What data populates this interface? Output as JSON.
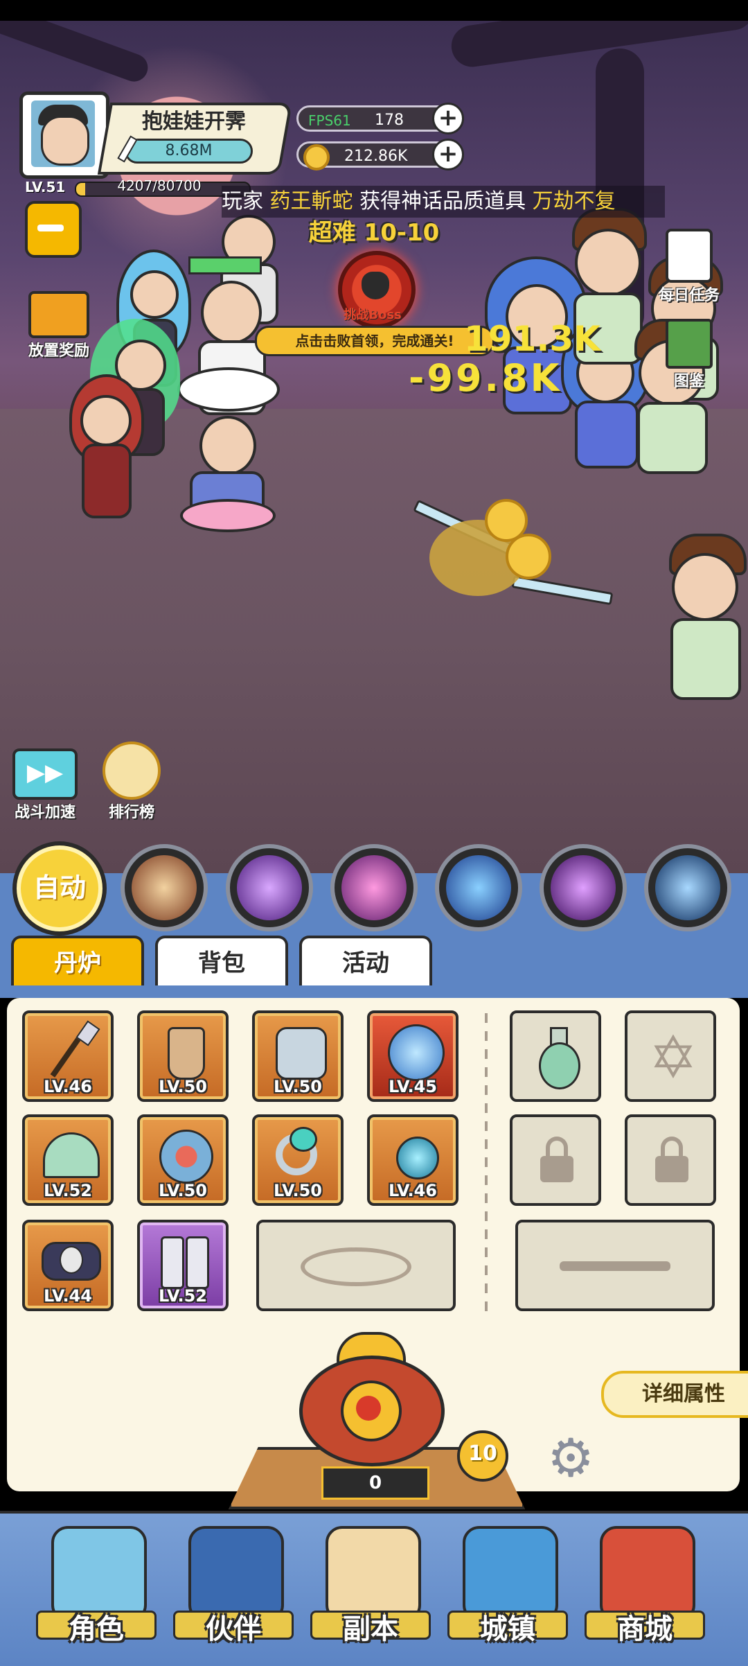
{
  "player": {
    "name": "抱娃娃开霁",
    "power": "8.68M",
    "level": "LV.51",
    "exp": "4207/80700"
  },
  "currencies": {
    "energy": "178",
    "energy_overlay": "FPS61",
    "gold": "212.86K"
  },
  "broadcast": {
    "prefix": "玩家",
    "player": "药王",
    "player2": "斬蛇",
    "middle": "获得神话品质道具",
    "item": "万劫不复"
  },
  "stage": {
    "difficulty_label": "超难 10-10",
    "boss_label": "挑战Boss",
    "hint": "点击击败首领，完成通关!"
  },
  "damage": {
    "top": "191.3K",
    "main": "-99.8K"
  },
  "side_buttons": {
    "daily_tasks": "每日任务",
    "codex": "图鉴",
    "idle_reward": "放置奖励",
    "battle_speed": "战斗加速",
    "leaderboard": "排行榜"
  },
  "skill_bar": {
    "auto_label": "自动"
  },
  "tabs": [
    "丹炉",
    "背包",
    "活动"
  ],
  "equipment": [
    {
      "level": "LV.46",
      "icon": "spear-icon",
      "rarity": "orange"
    },
    {
      "level": "LV.50",
      "icon": "cape-icon",
      "rarity": "orange"
    },
    {
      "level": "LV.50",
      "icon": "armor-icon",
      "rarity": "orange"
    },
    {
      "level": "LV.45",
      "icon": "dragon-orb-icon",
      "rarity": "red"
    },
    {
      "level": "LV.52",
      "icon": "fan-icon",
      "rarity": "orange"
    },
    {
      "level": "LV.50",
      "icon": "shield-icon",
      "rarity": "orange"
    },
    {
      "level": "LV.50",
      "icon": "ring-icon",
      "rarity": "orange"
    },
    {
      "level": "LV.46",
      "icon": "orb-icon",
      "rarity": "orange"
    },
    {
      "level": "LV.44",
      "icon": "skull-belt-icon",
      "rarity": "orange"
    },
    {
      "level": "LV.52",
      "icon": "boots-icon",
      "rarity": "purple"
    }
  ],
  "detail_button": "详细属性",
  "furnace": {
    "count": "0",
    "level_badge": "10"
  },
  "nav": [
    "角色",
    "伙伴",
    "副本",
    "城镇",
    "商城"
  ],
  "colors": {
    "panel_bg": "#fbf6e4",
    "tab_active": "#f5b800",
    "nav_bg": "#6a8fcf",
    "damage_text": "#f7e23a",
    "accent_red": "#d83a2a"
  }
}
